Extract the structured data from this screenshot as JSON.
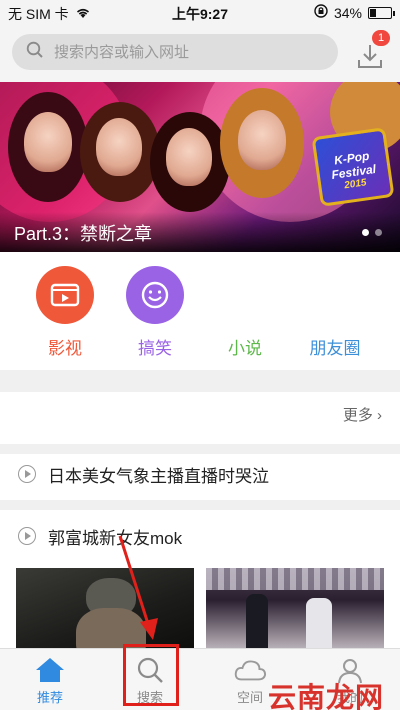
{
  "status_bar": {
    "carrier": "无 SIM 卡",
    "time": "上午9:27",
    "battery": "34%",
    "battery_level": 0.34
  },
  "search": {
    "placeholder": "搜索内容或输入网址"
  },
  "download": {
    "badge": "1"
  },
  "banner": {
    "caption": "Part.3：禁断之章",
    "badge_text": "K-Pop Festival",
    "badge_year": "2015",
    "slide_count": 2,
    "active_slide": 1
  },
  "categories": [
    {
      "label": "影视",
      "color": "#f0583a",
      "icon": "video-icon"
    },
    {
      "label": "搞笑",
      "color": "#9a63e6",
      "icon": "smile-icon"
    },
    {
      "label": "小说",
      "color": "#5db84a",
      "icon": "book-icon"
    },
    {
      "label": "朋友圈",
      "color": "#3d8fd8",
      "icon": "friends-icon"
    }
  ],
  "more": {
    "label": "更多 ›"
  },
  "news": [
    {
      "title": "日本美女气象主播直播时哭泣"
    },
    {
      "title": "郭富城新女友mok"
    }
  ],
  "tabs": [
    {
      "label": "推荐",
      "icon": "home-icon",
      "active": true
    },
    {
      "label": "搜索",
      "icon": "search-icon",
      "active": false
    },
    {
      "label": "空间",
      "icon": "cloud-icon",
      "active": false
    },
    {
      "label": "我的",
      "icon": "user-icon",
      "active": false
    }
  ],
  "watermark": "云南龙网",
  "colors": {
    "accent": "#2f8ae0",
    "highlight": "#e0201a",
    "badge": "#f0483e"
  }
}
